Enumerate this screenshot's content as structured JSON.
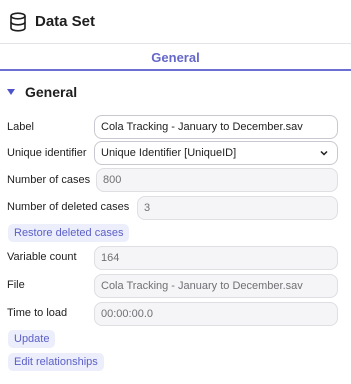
{
  "header": {
    "title": "Data Set",
    "icon": "database-icon"
  },
  "tabs": [
    {
      "label": "General",
      "active": true
    }
  ],
  "section": {
    "title": "General",
    "expanded": true
  },
  "fields": {
    "label": {
      "label": "Label",
      "value": "Cola Tracking - January to December.sav"
    },
    "unique_identifier": {
      "label": "Unique identifier",
      "value": "Unique Identifier [UniqueID]"
    },
    "number_of_cases": {
      "label": "Number of cases",
      "value": "800"
    },
    "number_of_deleted_cases": {
      "label": "Number of deleted cases",
      "value": "3"
    },
    "variable_count": {
      "label": "Variable count",
      "value": "164"
    },
    "file": {
      "label": "File",
      "value": "Cola Tracking - January to December.sav"
    },
    "time_to_load": {
      "label": "Time to load",
      "value": "00:00:00.0"
    }
  },
  "buttons": {
    "restore_deleted_cases": "Restore deleted cases",
    "update": "Update",
    "edit_relationships": "Edit relationships"
  },
  "colors": {
    "accent": "#6568c9",
    "button_bg": "#eceefb",
    "caret": "#4f53c9"
  }
}
